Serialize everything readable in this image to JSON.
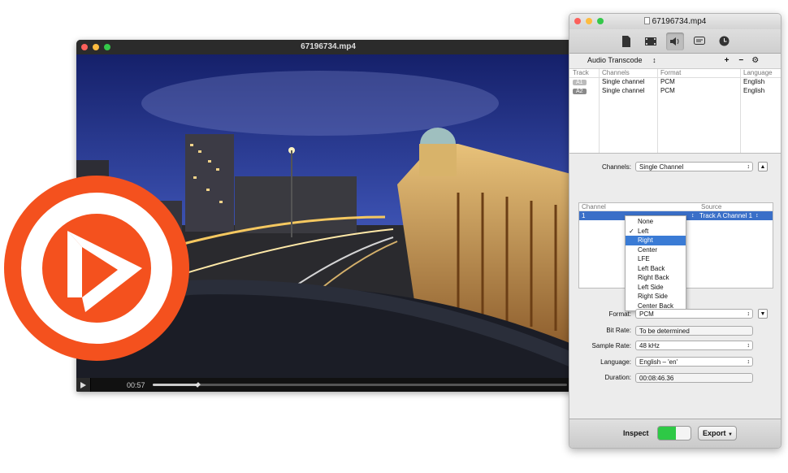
{
  "player": {
    "title": "67196734.mp4",
    "time": "00:57",
    "progress": 0.11
  },
  "inspector": {
    "title": "67196734.mp4",
    "tabs": [
      "document-icon",
      "film-icon",
      "audio-icon",
      "subtitle-icon",
      "clock-icon"
    ],
    "transcode_label": "Audio Transcode",
    "add": "+",
    "remove": "−",
    "table": {
      "headers": [
        "Track",
        "Channels",
        "Format",
        "Language"
      ],
      "rows": [
        [
          "A1",
          "Single channel",
          "PCM",
          "English"
        ],
        [
          "A2",
          "Single channel",
          "PCM",
          "English"
        ]
      ]
    },
    "channels_label": "Channels:",
    "channels_value": "Single Channel",
    "map_headers": [
      "Channel",
      "Source"
    ],
    "map_row": {
      "channel": "1",
      "source": "Track A Channel 1"
    },
    "menu": {
      "items": [
        "None",
        "Left",
        "Right",
        "Center",
        "LFE",
        "Left Back",
        "Right Back",
        "Left Side",
        "Right Side",
        "Center Back"
      ],
      "checked": "Left",
      "highlighted": "Right"
    },
    "format_label": "Format:",
    "format_value": "PCM",
    "bitrate_label": "Bit Rate:",
    "bitrate_value": "To be determined",
    "samplerate_label": "Sample Rate:",
    "samplerate_value": "48 kHz",
    "language_label": "Language:",
    "language_value": "English – 'en'",
    "duration_label": "Duration:",
    "duration_value": "00:08:46.36",
    "inspect_label": "Inspect",
    "export_label": "Export"
  }
}
